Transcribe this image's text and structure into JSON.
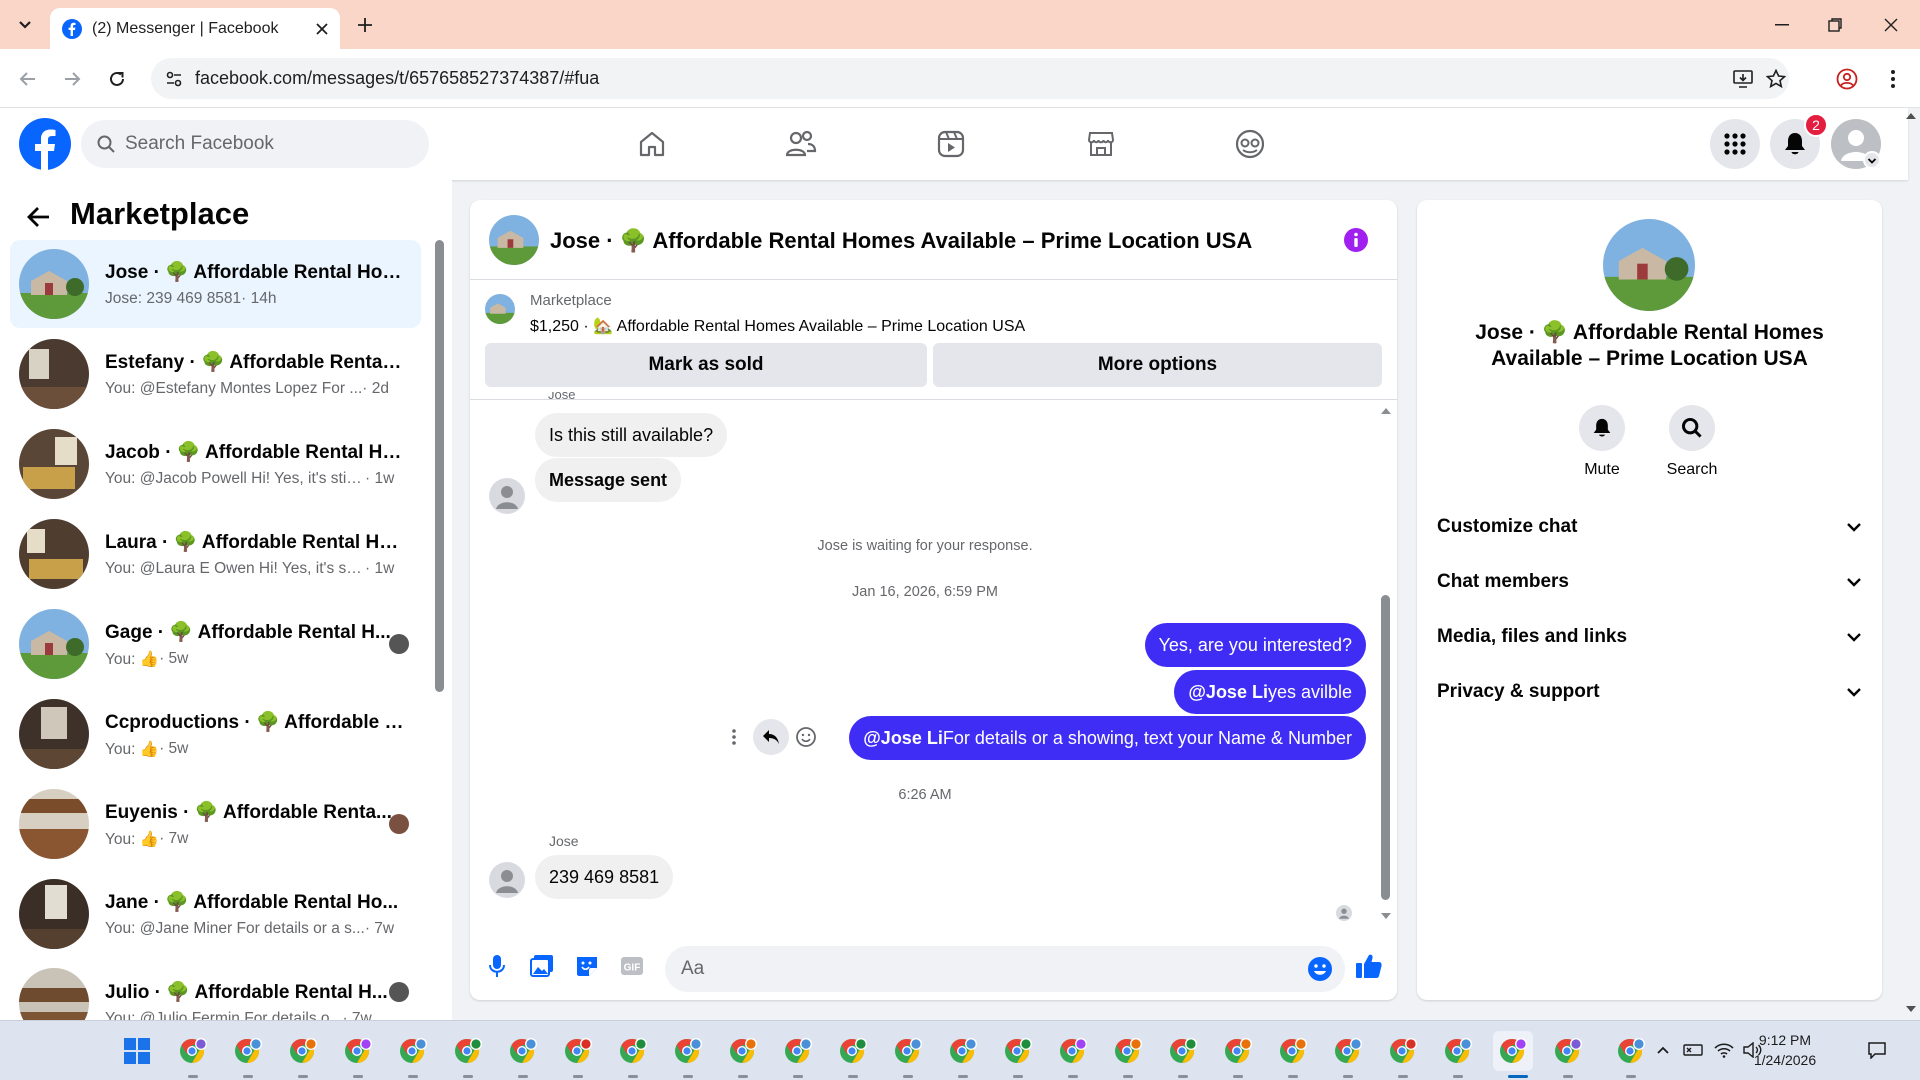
{
  "browser": {
    "tab_title": "(2) Messenger | Facebook",
    "url": "facebook.com/messages/t/657658527374387/#fua"
  },
  "fb_header": {
    "search_placeholder": "Search Facebook",
    "notification_count": "2",
    "brand_color": "#0866ff"
  },
  "sidebar": {
    "title": "Marketplace",
    "conversations": [
      {
        "name": "Jose · 🌳 Affordable Rental Hom...",
        "preview": "Jose: 239 469 8581",
        "time": "· 14h"
      },
      {
        "name": "Estefany · 🌳 Affordable Rental ...",
        "preview": "You: @Estefany Montes Lopez For ...",
        "time": "· 2d"
      },
      {
        "name": "Jacob · 🌳 Affordable Rental Ho...",
        "preview": "You: @Jacob Powell Hi! Yes, it's still...",
        "time": "· 1w"
      },
      {
        "name": "Laura · 🌳 Affordable Rental Ho...",
        "preview": "You: @Laura E Owen Hi! Yes, it's stil...",
        "time": "· 1w"
      },
      {
        "name": "Gage · 🌳 Affordable Rental H...",
        "preview": "You: 👍",
        "time": "· 5w"
      },
      {
        "name": "Ccproductions · 🌳 Affordable R...",
        "preview": "You: 👍",
        "time": "· 5w"
      },
      {
        "name": "Euyenis · 🌳 Affordable Renta...",
        "preview": "You: 👍",
        "time": "· 7w"
      },
      {
        "name": "Jane · 🌳 Affordable Rental Ho...",
        "preview": "You: @Jane Miner For details or a s...",
        "time": "· 7w"
      },
      {
        "name": "Julio · 🌳 Affordable Rental H...",
        "preview": "You: @Julio Fermin For details o...",
        "time": "· 7w"
      }
    ]
  },
  "chat": {
    "title": "Jose · 🌳 Affordable Rental Homes Available – Prime Location USA",
    "marketplace_label": "Marketplace",
    "listing": "$1,250 · 🏡 Affordable Rental Homes Available – Prime Location USA",
    "mark_sold": "Mark as sold",
    "more_options": "More options",
    "top_sender": "Jose",
    "messages": {
      "in1": "Is this still available?",
      "in2": "Message sent",
      "waiting": "Jose is waiting for your response.",
      "date1": "Jan 16, 2026, 6:59 PM",
      "out1": "Yes, are you interested?",
      "out2_mention": "@Jose Li",
      "out2_text": " yes avilble",
      "out3_mention": "@Jose Li",
      "out3_text": " For details or a showing, text your Name & Number",
      "date2": "6:26 AM",
      "sender": "Jose",
      "in3": "239 469 8581"
    },
    "composer_placeholder": "Aa",
    "accent": "#3f2df5"
  },
  "details": {
    "name": "Jose · 🌳 Affordable Rental Homes Available – Prime Location USA",
    "mute": "Mute",
    "search": "Search",
    "rows": [
      "Customize chat",
      "Chat members",
      "Media, files and links",
      "Privacy & support"
    ]
  },
  "taskbar": {
    "time": "9:12 PM",
    "date": "1/24/2026"
  }
}
